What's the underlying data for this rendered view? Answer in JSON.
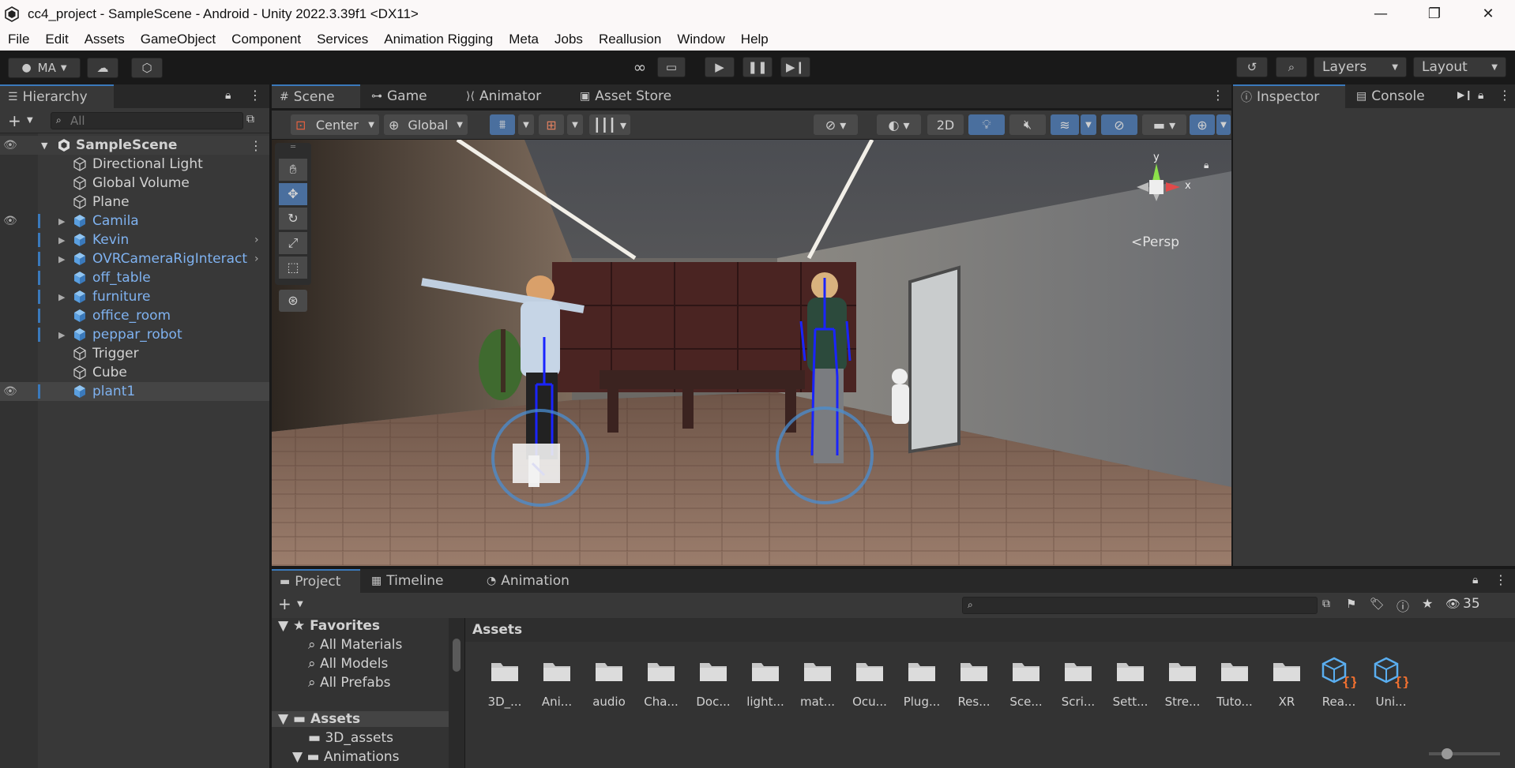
{
  "window": {
    "title": "cc4_project - SampleScene - Android - Unity 2022.3.39f1 <DX11>",
    "minimize": "—",
    "maximize": "❐",
    "close": "✕"
  },
  "menu": [
    "File",
    "Edit",
    "Assets",
    "GameObject",
    "Component",
    "Services",
    "Animation Rigging",
    "Meta",
    "Jobs",
    "Reallusion",
    "Window",
    "Help"
  ],
  "toolbar": {
    "account": "MA",
    "layers": "Layers",
    "layout": "Layout"
  },
  "hierarchy": {
    "tab": "Hierarchy",
    "search_placeholder": "All",
    "scene": "SampleScene",
    "items": [
      {
        "label": "Directional Light",
        "type": "object"
      },
      {
        "label": "Global Volume",
        "type": "object"
      },
      {
        "label": "Plane",
        "type": "object"
      },
      {
        "label": "Camila",
        "type": "prefab"
      },
      {
        "label": "Kevin",
        "type": "prefab"
      },
      {
        "label": "OVRCameraRigInteract",
        "type": "prefab"
      },
      {
        "label": "off_table",
        "type": "prefab"
      },
      {
        "label": "furniture",
        "type": "prefab"
      },
      {
        "label": "office_room",
        "type": "prefab"
      },
      {
        "label": "peppar_robot",
        "type": "prefab"
      },
      {
        "label": "Trigger",
        "type": "object"
      },
      {
        "label": "Cube",
        "type": "object"
      },
      {
        "label": "plant1",
        "type": "prefab"
      }
    ]
  },
  "scene_tabs": [
    "Scene",
    "Game",
    "Animator",
    "Asset Store"
  ],
  "scene_toolbar": {
    "pivot": "Center",
    "space": "Global",
    "mode_2d": "2D"
  },
  "gizmo": {
    "y": "y",
    "x": "x",
    "projection": "Persp"
  },
  "right_tabs": [
    "Inspector",
    "Console"
  ],
  "project": {
    "tabs": [
      "Project",
      "Timeline",
      "Animation"
    ],
    "hidden_count": "35",
    "favorites": "Favorites",
    "favorite_items": [
      "All Materials",
      "All Models",
      "All Prefabs"
    ],
    "assets_root": "Assets",
    "asset_tree": [
      "3D_assets",
      "Animations"
    ],
    "breadcrumb": "Assets",
    "folders": [
      "3D_...",
      "Ani...",
      "audio",
      "Cha...",
      "Doc...",
      "light...",
      "mat...",
      "Ocu...",
      "Plug...",
      "Res...",
      "Sce...",
      "Scri...",
      "Sett...",
      "Stre...",
      "Tuto...",
      "XR"
    ],
    "scripts": [
      "Rea...",
      "Uni..."
    ]
  },
  "colors": {
    "accent": "#3a79bb",
    "prefab_text": "#7fb2f0",
    "panel": "#383838",
    "dark": "#191919"
  }
}
